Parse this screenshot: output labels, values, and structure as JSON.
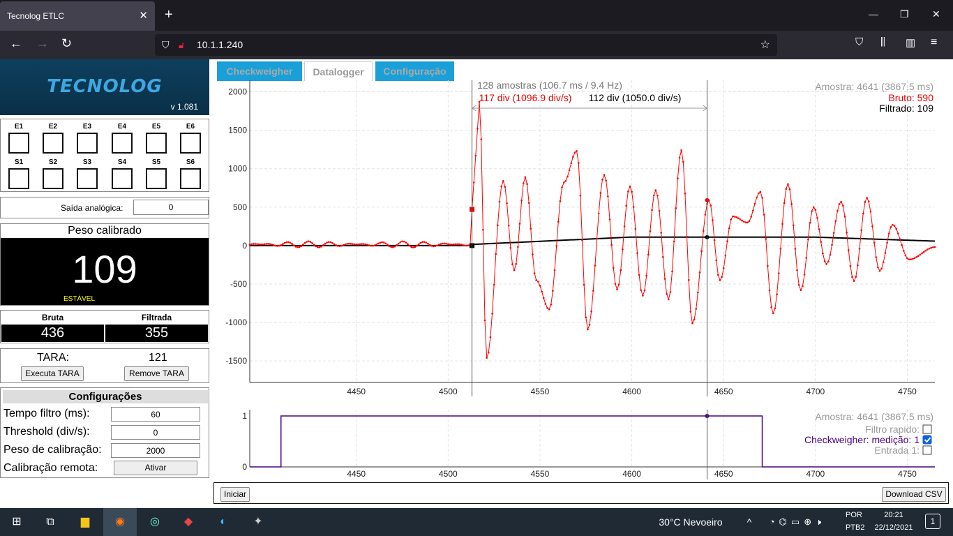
{
  "browser": {
    "tab_title": "Tecnolog ETLC",
    "tab_close": "✕",
    "new_tab": "+",
    "url": "10.1.1.240",
    "win_min": "—",
    "win_max": "❐",
    "win_close": "✕"
  },
  "sidebar": {
    "logo": "TECNOLOG",
    "version": "v 1.081",
    "inputs": [
      "E1",
      "E2",
      "E3",
      "E4",
      "E5",
      "E6"
    ],
    "outputs": [
      "S1",
      "S2",
      "S3",
      "S4",
      "S5",
      "S6"
    ],
    "analog_label": "Saída analógica:",
    "analog_value": "0",
    "peso_title": "Peso calibrado",
    "peso_value": "109",
    "peso_status": "ESTÁVEL",
    "bruta_label": "Bruta",
    "bruta_value": "436",
    "filtrada_label": "Filtrada",
    "filtrada_value": "355",
    "tara_label": "TARA:",
    "tara_value": "121",
    "executa_tara": "Executa TARA",
    "remove_tara": "Remove TARA",
    "config_title": "Configurações",
    "config": [
      {
        "label": "Tempo filtro (ms):",
        "value": "60"
      },
      {
        "label": "Threshold (div/s):",
        "value": "0"
      },
      {
        "label": "Peso de calibração:",
        "value": "2000"
      },
      {
        "label": "Calibração remota:",
        "value": "Ativar"
      }
    ]
  },
  "tabs": [
    {
      "label": "Checkweigher",
      "active": false
    },
    {
      "label": "Datalogger",
      "active": true
    },
    {
      "label": "Configuração",
      "active": false
    }
  ],
  "colors": {
    "bruto": "#ff0000",
    "filtrado": "#000000",
    "checkweigher": "#4b0082",
    "tab_inactive": "#1aa0d8"
  },
  "chart_data": [
    {
      "type": "line",
      "xlim": [
        4392,
        4765
      ],
      "ylim": [
        -1780,
        2150
      ],
      "xticks": [
        4450,
        4500,
        4550,
        4600,
        4650,
        4700,
        4750
      ],
      "yticks": [
        2000,
        1500,
        1000,
        500,
        0,
        -500,
        -1000,
        -1500
      ],
      "cursor1_x": 4513,
      "cursor2_x": 4641,
      "annotation_samples": "128 amostras (106.7 ms / 9.4 Hz)",
      "annotation_bruto": "117 div (1096.9 div/s)",
      "annotation_filtrado": "112 div (1050.0 div/s)",
      "readout_sample": "Amostra: 4641 (3867.5 ms)",
      "readout_bruto": "Bruto: 590",
      "readout_filtrado": "Filtrado: 109",
      "series": [
        {
          "name": "Bruto",
          "color": "#ff0000"
        },
        {
          "name": "Filtrado",
          "color": "#000000"
        }
      ]
    },
    {
      "type": "line",
      "xlim": [
        4392,
        4765
      ],
      "ylim": [
        0,
        1
      ],
      "xticks": [
        4450,
        4500,
        4550,
        4600,
        4650,
        4700,
        4750
      ],
      "yticks": [
        1,
        0
      ],
      "cursor_x": 4641,
      "readout_sample": "Amostra: 4641 (3867.5 ms)",
      "legend": [
        {
          "label": "Filtro rapido:",
          "checked": false,
          "color": "#999999"
        },
        {
          "label": "Checkweigher: medição: 1",
          "checked": true,
          "color": "#4b0082"
        },
        {
          "label": "Entrada 1:",
          "checked": false,
          "color": "#999999"
        }
      ],
      "series": [
        {
          "name": "Checkweigher: medição",
          "color": "#4b0082",
          "points": [
            [
              4392,
              0
            ],
            [
              4409,
              0
            ],
            [
              4409,
              1
            ],
            [
              4671,
              1
            ],
            [
              4671,
              0
            ],
            [
              4765,
              0
            ]
          ]
        }
      ]
    }
  ],
  "footer": {
    "iniciar": "Iniciar",
    "download": "Download CSV"
  },
  "taskbar": {
    "weather": "30°C  Nevoeiro",
    "lang1": "POR",
    "lang2": "PTB2",
    "time": "20:21",
    "date": "22/12/2021",
    "notif": "1"
  }
}
